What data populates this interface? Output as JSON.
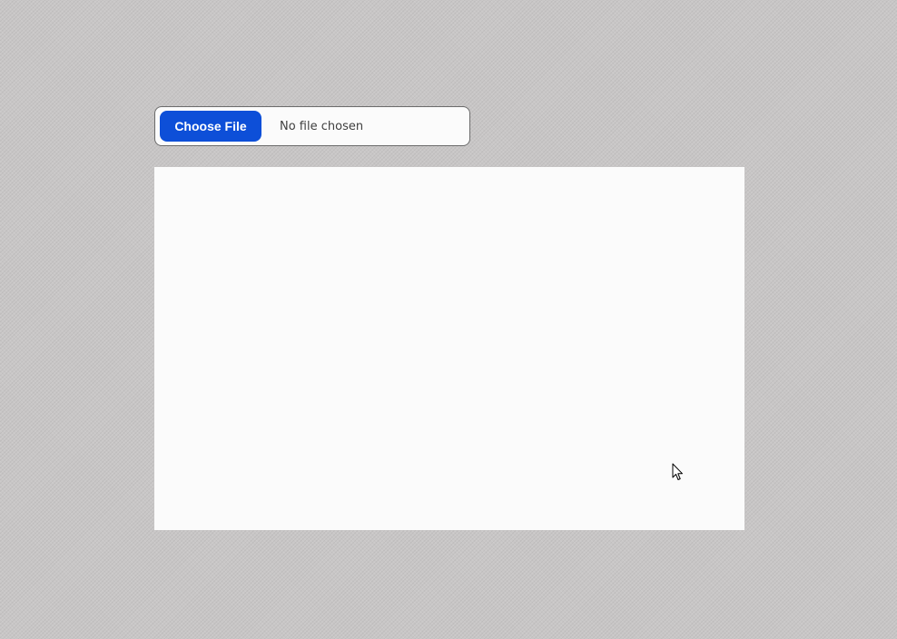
{
  "file_picker": {
    "button_label": "Choose File",
    "status_text": "No file chosen",
    "button_color": "#0d4fd8"
  },
  "preview": {
    "background": "#fbfbfb"
  },
  "cursor": {
    "icon": "arrow-cursor-icon"
  }
}
